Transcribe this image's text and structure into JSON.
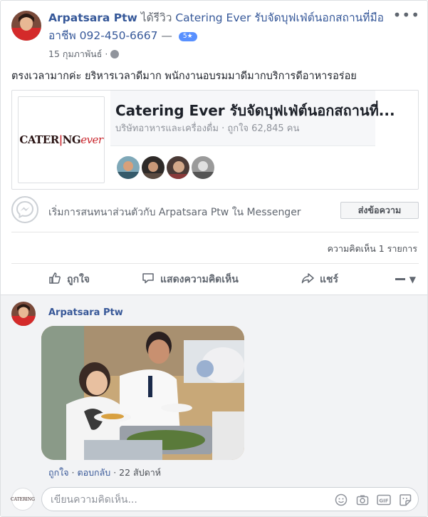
{
  "post": {
    "author": "Arpatsara Ptw",
    "verb": " ได้รีวิว ",
    "page": "Catering Ever รับจัดบุฟเฟ่ต์นอกสถานที่มืออาชีพ 092-450-6667",
    "dash": " — ",
    "rating": "5★",
    "date": "15 กุมภาพันธ์ ·",
    "review": "ตรงเวลามากค่ะ ยริหารเวลาดีมาก พนักงานอบรมมาดีมากบริการดีอาหารอร่อย"
  },
  "page_card": {
    "name": "Catering Ever รับจัดบุฟเฟ่ต์นอกสถานที่...",
    "subtitle": "บริษัทอาหารและเครื่องดื่ม · ถูกใจ 62,845 คน",
    "logo_main": "CATER",
    "logo_sep": "|",
    "logo_ng": "NG",
    "logo_ever": "ever"
  },
  "messenger": {
    "text": "เริ่มการสนทนาส่วนตัวกับ Arpatsara Ptw ใน Messenger",
    "button": "ส่งข้อความ"
  },
  "comment_count": "ความคิดเห็น 1 รายการ",
  "actions": {
    "like": "ถูกใจ",
    "comment": "แสดงความคิดเห็น",
    "share": "แชร์"
  },
  "comment": {
    "author": "Arpatsara Ptw",
    "like": "ถูกใจ",
    "sep1": " · ",
    "reply": "ตอบกลับ",
    "sep2": " · ",
    "time": "22 สัปดาห์"
  },
  "composer": {
    "placeholder": "เขียนความคิดเห็น..."
  },
  "colors": {
    "link": "#365899",
    "badge": "#5890ff",
    "muted": "#616770"
  }
}
